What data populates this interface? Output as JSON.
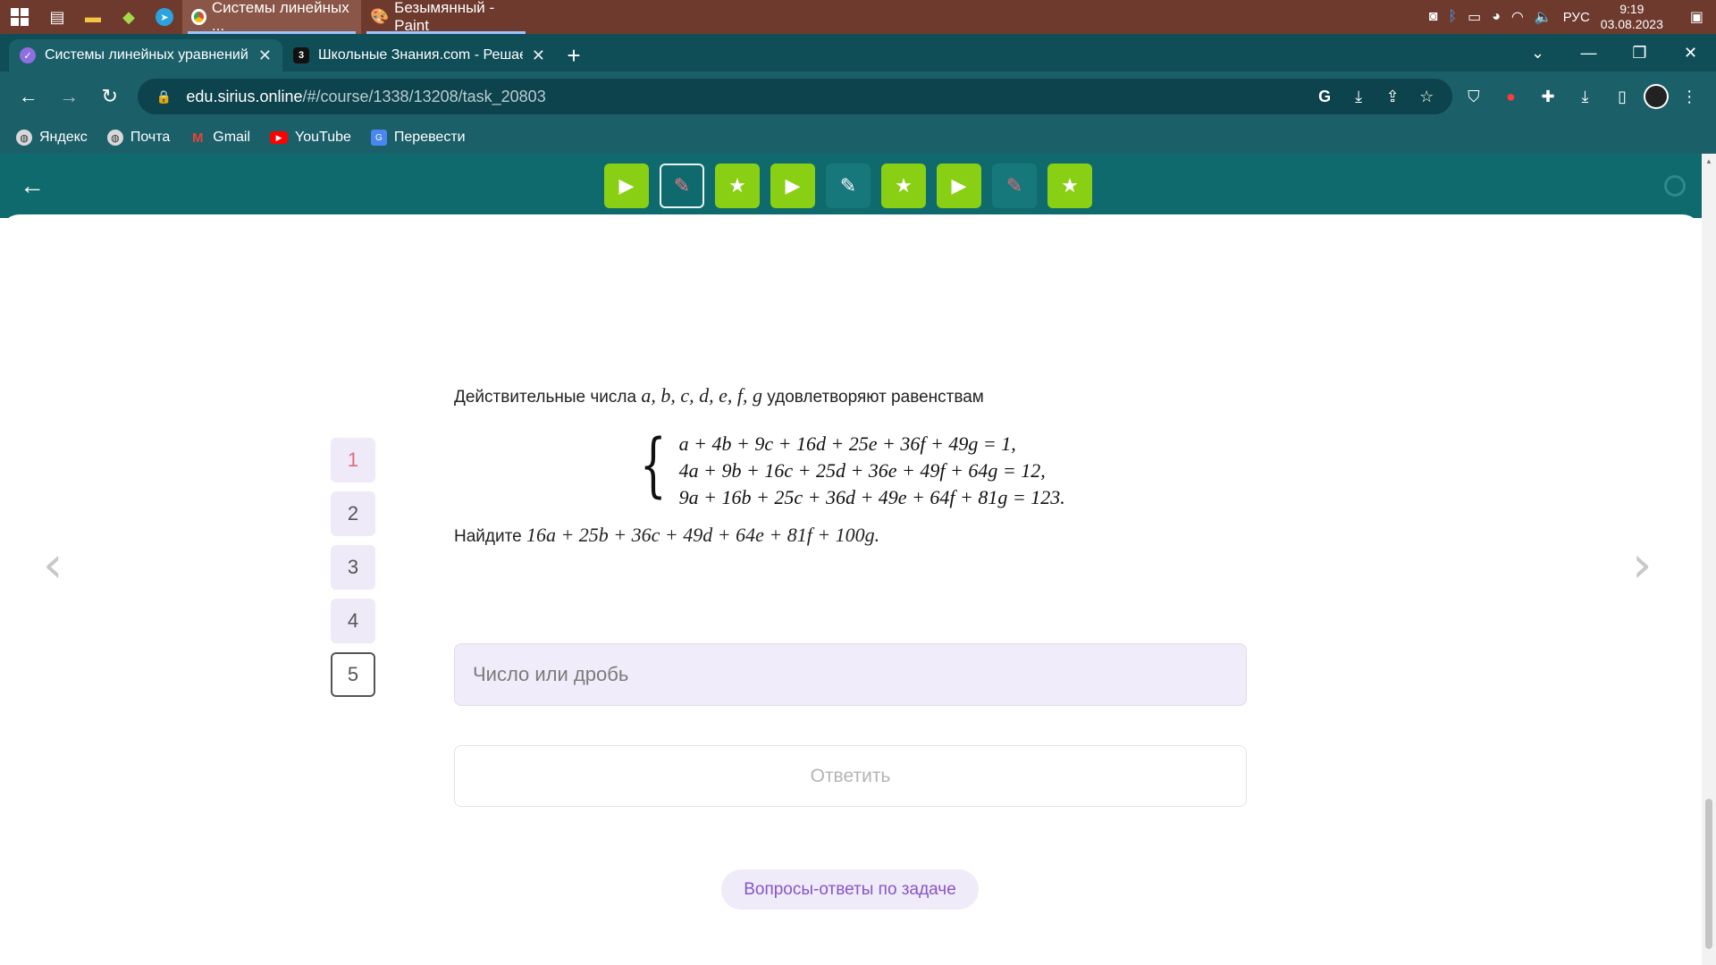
{
  "taskbar": {
    "apps": [
      {
        "label": "Системы линейных ...",
        "active": true
      },
      {
        "label": "Безымянный - Paint",
        "active": false
      }
    ],
    "lang": "РУС",
    "time": "9:19",
    "date": "03.08.2023"
  },
  "browser": {
    "tabs": [
      {
        "title": "Системы линейных уравнений",
        "active": true
      },
      {
        "title": "Школьные Знания.com - Решае",
        "active": false
      }
    ],
    "url_host": "edu.sirius.online",
    "url_path": "/#/course/1338/13208/task_20803",
    "bookmarks": [
      "Яндекс",
      "Почта",
      "Gmail",
      "YouTube",
      "Перевести"
    ]
  },
  "course_nav": {
    "tasks": [
      {
        "icon": "play",
        "state": "done"
      },
      {
        "icon": "pencil",
        "state": "current"
      },
      {
        "icon": "star",
        "state": "done"
      },
      {
        "icon": "play",
        "state": "done"
      },
      {
        "icon": "pencil",
        "state": "todo"
      },
      {
        "icon": "star",
        "state": "done"
      },
      {
        "icon": "play",
        "state": "done"
      },
      {
        "icon": "pencil",
        "state": "failed"
      },
      {
        "icon": "star",
        "state": "done"
      }
    ]
  },
  "subtasks": [
    "1",
    "2",
    "3",
    "4",
    "5"
  ],
  "problem": {
    "intro_prefix": "Действительные числа",
    "intro_vars": "a, b, c, d, e, f, g",
    "intro_suffix": "удовлетворяют равенствам",
    "equations": [
      "a + 4b + 9c + 16d + 25e + 36f + 49g = 1,",
      "4a + 9b + 16c + 25d + 36e + 49f + 64g = 12,",
      "9a + 16b + 25c + 36d + 49e + 64f + 81g = 123."
    ],
    "find_prefix": "Найдите",
    "find_expr": "16a + 25b + 36c + 49d + 64e + 81f + 100g."
  },
  "answer": {
    "placeholder": "Число или дробь",
    "value": "",
    "submit_label": "Ответить"
  },
  "qa_label": "Вопросы-ответы по задаче"
}
